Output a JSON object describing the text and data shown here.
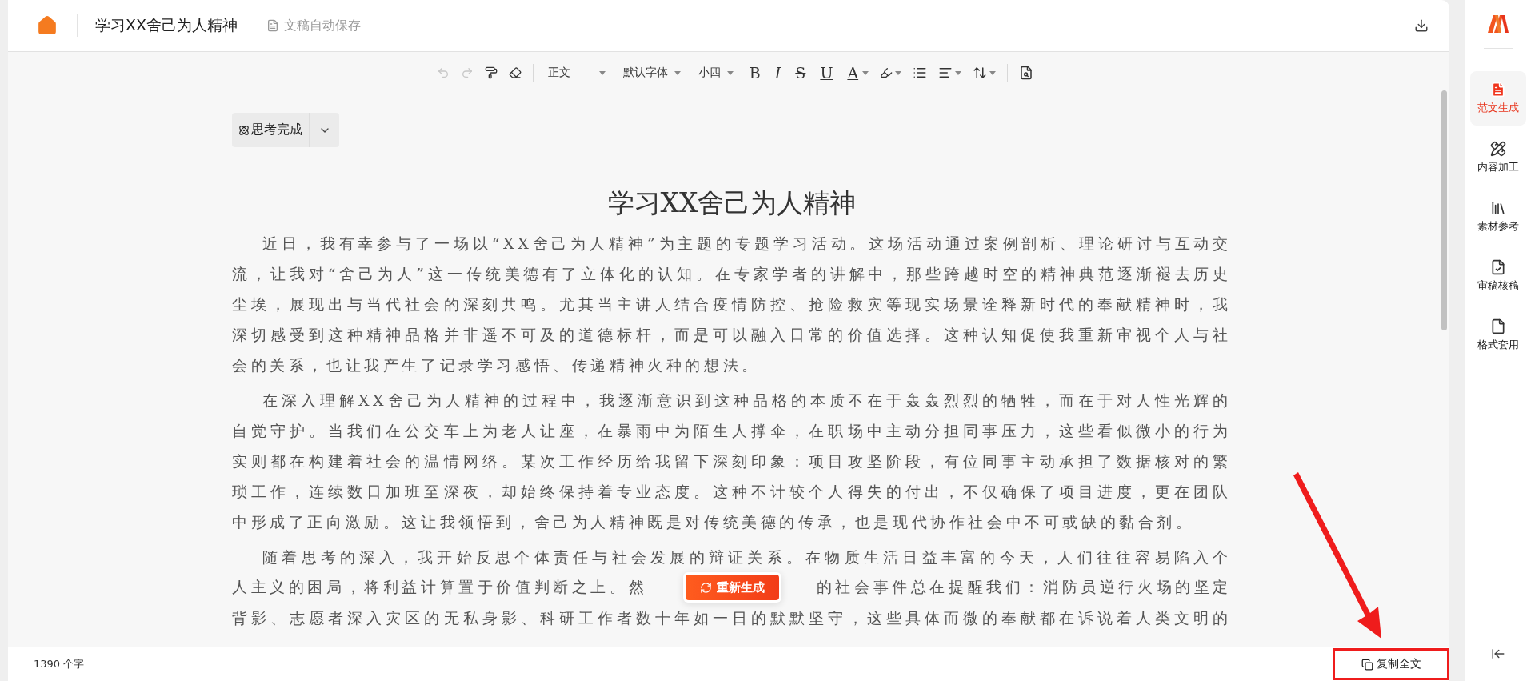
{
  "header": {
    "title": "学习XX舍己为人精神",
    "save_status": "文稿自动保存"
  },
  "toolbar": {
    "undo_disabled": true,
    "redo_disabled": true,
    "paragraph_style": "正文",
    "font": "默认字体",
    "font_size": "小四",
    "format_letters": [
      {
        "kind": "bold",
        "label": "B"
      },
      {
        "kind": "italic",
        "label": "I"
      },
      {
        "kind": "strike",
        "label": "S"
      },
      {
        "kind": "underline",
        "label": "U"
      },
      {
        "kind": "color",
        "label": "A"
      }
    ]
  },
  "think_status": {
    "label": "思考完成",
    "expanded": false
  },
  "document": {
    "title": "学习XX舍己为人精神",
    "paragraphs": [
      "近日，我有幸参与了一场以“XX舍己为人精神”为主题的专题学习活动。这场活动通过案例剖析、理论研讨与互动交流，让我对“舍己为人”这一传统美德有了立体化的认知。在专家学者的讲解中，那些跨越时空的精神典范逐渐褪去历史尘埃，展现出与当代社会的深刻共鸣。尤其当主讲人结合疫情防控、抢险救灾等现实场景诠释新时代的奉献精神时，我深切感受到这种精神品格并非遥不可及的道德标杆，而是可以融入日常的价值选择。这种认知促使我重新审视个人与社会的关系，也让我产生了记录学习感悟、传递精神火种的想法。",
      "在深入理解XX舍己为人精神的过程中，我逐渐意识到这种品格的本质不在于轰轰烈烈的牺牲，而在于对人性光辉的自觉守护。当我们在公交车上为老人让座，在暴雨中为陌生人撑伞，在职场中主动分担同事压力，这些看似微小的行为实则都在构建着社会的温情网络。某次工作经历给我留下深刻印象：项目攻坚阶段，有位同事主动承担了数据核对的繁琐工作，连续数日加班至深夜，却始终保持着专业态度。这种不计较个人得失的付出，不仅确保了项目进度，更在团队中形成了正向激励。这让我领悟到，舍己为人精神既是对传统美德的传承，也是现代协作社会中不可或缺的黏合剂。"
    ],
    "partial_lines": [
      {
        "kind": "full",
        "text": "随着思考的深入，我开始反思个体责任与社会发展的辩证关系。在物质生活日益丰富的今天，人们往往容易陷入个"
      },
      {
        "kind": "split",
        "left": "人主义的困局，将利益计算置于价值判断之上。然",
        "right": "的社会事件总在提醒我们：消防员逆行火场的坚定"
      },
      {
        "kind": "full",
        "text": "背影、志愿者深入灾区的无私身影、科研工作者数十年如一日的默默坚守，这些具体而微的奉献都在诉说着人类文明的"
      }
    ]
  },
  "regenerate_button": "重新生成",
  "footer": {
    "word_count": "1390 个字",
    "copy_button": {
      "label": "复制全文",
      "highlighted": true
    }
  },
  "sidebar": {
    "items": [
      {
        "kind": "generate",
        "label": "范文生成",
        "selected": true
      },
      {
        "kind": "process",
        "label": "内容加工",
        "selected": false
      },
      {
        "kind": "material",
        "label": "素材参考",
        "selected": false
      },
      {
        "kind": "review",
        "label": "审稿核稿",
        "selected": false
      },
      {
        "kind": "format",
        "label": "格式套用",
        "selected": false
      }
    ]
  }
}
